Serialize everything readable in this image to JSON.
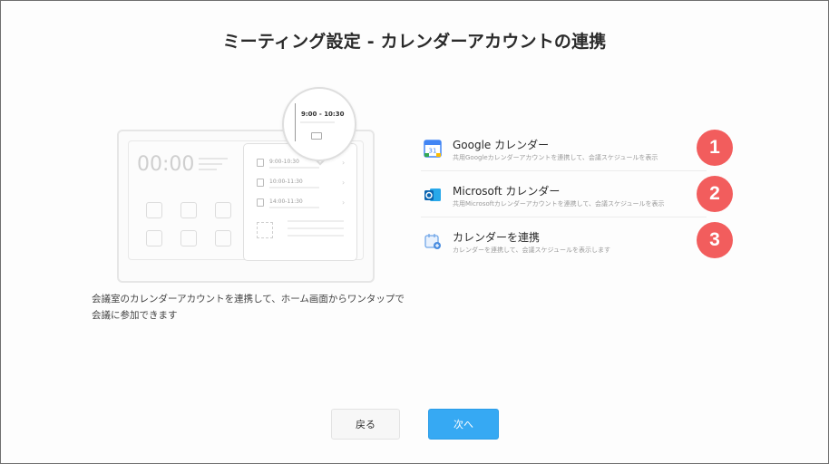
{
  "dialog": {
    "title": "ミーティング設定 - カレンダーアカウントの連携"
  },
  "illustration": {
    "clock": "00:00",
    "bubble_time": "9:00 - 10:30",
    "events": [
      {
        "time": "9:00-10:30"
      },
      {
        "time": "10:00-11:30"
      },
      {
        "time": "14:00-11:30"
      }
    ]
  },
  "description": "会議室のカレンダーアカウントを連携して、ホーム画面からワンタップで会議に参加できます",
  "options": [
    {
      "title": "Google カレンダー",
      "subtitle": "共用Googleカレンダーアカウントを連携して、会議スケジュールを表示",
      "icon": "google-calendar-icon",
      "badge": "1"
    },
    {
      "title": "Microsoft カレンダー",
      "subtitle": "共用Microsoftカレンダーアカウントを連携して、会議スケジュールを表示",
      "icon": "outlook-icon",
      "badge": "2"
    },
    {
      "title": "カレンダーを連携",
      "subtitle": "カレンダーを連携して、会議スケジュールを表示します",
      "icon": "calendar-add-icon",
      "badge": "3"
    }
  ],
  "buttons": {
    "back": "戻る",
    "next": "次へ"
  },
  "colors": {
    "accent": "#36a9f3",
    "badge": "#f25d5d"
  }
}
